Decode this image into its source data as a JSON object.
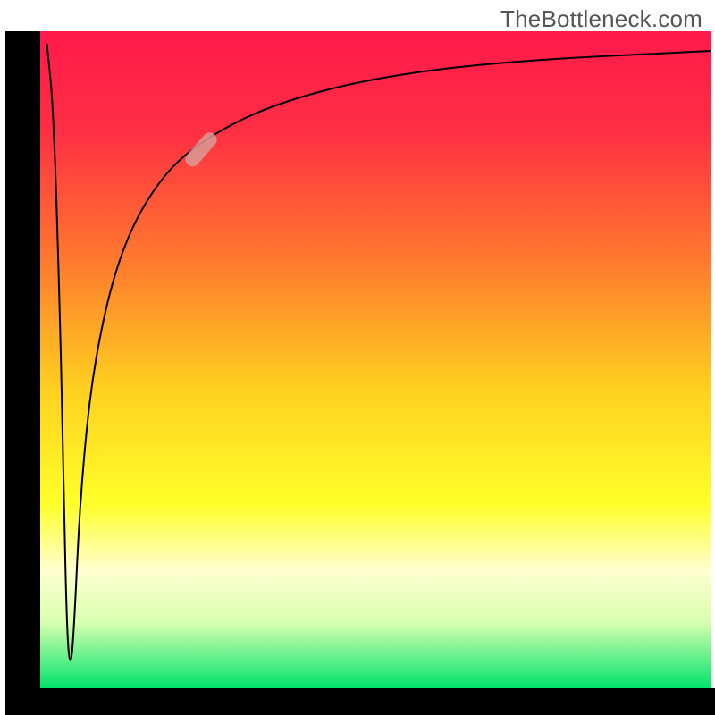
{
  "watermark": "TheBottleneck.com",
  "chart_data": {
    "type": "line",
    "title": "",
    "xlabel": "",
    "ylabel": "",
    "xlim": [
      0,
      100
    ],
    "ylim": [
      0,
      100
    ],
    "grid": false,
    "legend": false,
    "background_gradient": {
      "stops": [
        {
          "offset": 0.0,
          "color": "#ff1a4b"
        },
        {
          "offset": 0.15,
          "color": "#ff2e44"
        },
        {
          "offset": 0.35,
          "color": "#ff7a2e"
        },
        {
          "offset": 0.55,
          "color": "#ffd21f"
        },
        {
          "offset": 0.72,
          "color": "#ffff2a"
        },
        {
          "offset": 0.82,
          "color": "#ffffd0"
        },
        {
          "offset": 0.9,
          "color": "#d8ffb0"
        },
        {
          "offset": 1.0,
          "color": "#00e36b"
        }
      ]
    },
    "axis_left": true,
    "axis_bottom": true,
    "highlight_marker": {
      "x_pct": 24,
      "y_pct": 82,
      "length_pct": 6,
      "color": "#d99b94",
      "opacity": 0.85
    },
    "series": [
      {
        "name": "bottleneck-curve",
        "color": "#000000",
        "stroke_width": 2,
        "points": [
          {
            "x": 1.0,
            "y": 98
          },
          {
            "x": 2.0,
            "y": 88
          },
          {
            "x": 3.0,
            "y": 55
          },
          {
            "x": 3.5,
            "y": 30
          },
          {
            "x": 4.0,
            "y": 8
          },
          {
            "x": 4.5,
            "y": 3
          },
          {
            "x": 5.0,
            "y": 8
          },
          {
            "x": 6.0,
            "y": 30
          },
          {
            "x": 8.0,
            "y": 50
          },
          {
            "x": 12.0,
            "y": 67
          },
          {
            "x": 18.0,
            "y": 78
          },
          {
            "x": 25.0,
            "y": 84
          },
          {
            "x": 35.0,
            "y": 89
          },
          {
            "x": 50.0,
            "y": 93
          },
          {
            "x": 70.0,
            "y": 95.5
          },
          {
            "x": 100.0,
            "y": 97
          }
        ]
      }
    ]
  }
}
